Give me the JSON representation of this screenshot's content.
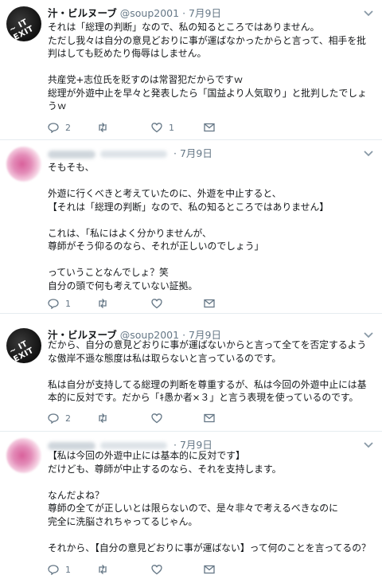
{
  "tweets": [
    {
      "avatar_text": "~ IT EXIT",
      "name": "汁・ビルヌーブ",
      "handle": "@soup2001",
      "separator": "·",
      "date": "7月9日",
      "text": "それは「総理の判断」なので、私の知るところではありません。\nただし我々は自分の意見どおりに事が運ばなかったからと言って、相手を批判はしても貶めたり侮辱はしません。\n\n共産党+志位氏を貶すのは常習犯だからですｗ\n総理が外遊中止を早々と発表したら「国益より人気取り」と批判したでしょうｗ",
      "reply_count": "2",
      "retweet_count": "",
      "like_count": "1"
    },
    {
      "separator": "·",
      "date": "7月9日",
      "text": "そもそも、\n\n外遊に行くべきと考えていたのに、外遊を中止すると、\n【それは「総理の判断」なので、私の知るところではありません】\n\nこれは、「私にはよく分かりませんが、\n尊師がそう仰るのなら、それが正しいのでしょう」\n\nっていうことなんでしょ？笑\n自分の頭で何も考えていない証拠。",
      "reply_count": "1",
      "retweet_count": "",
      "like_count": ""
    },
    {
      "avatar_text": "~ IT EXIT",
      "name": "汁・ビルヌーブ",
      "handle": "@soup2001",
      "separator": "·",
      "date": "7月9日",
      "text": "だから、自分の意見どおりに事が運ばないからと言って全てを否定するような傲岸不遜な態度は私は取らないと言っているのです。\n\n私は自分が支持してる総理の判断を尊重するが、私は今回の外遊中止には基本的に反対です。だから「ｷ愚か者×３」と言う表現を使っているのです。",
      "reply_count": "2",
      "retweet_count": "",
      "like_count": ""
    },
    {
      "separator": "·",
      "date": "7月9日",
      "text": "【私は今回の外遊中止には基本的に反対です】\nだけども、尊師が中止するのなら、それを支持します。\n\nなんだよね？\n尊師の全てが正しいとは限らないので、是々非々で考えるべきなのに\n完全に洗脳されちゃってるじゃん。\n\nそれから、【自分の意見どおりに事が運ばない】って何のことを言ってるの？",
      "reply_count": "1",
      "retweet_count": "",
      "like_count": ""
    }
  ]
}
